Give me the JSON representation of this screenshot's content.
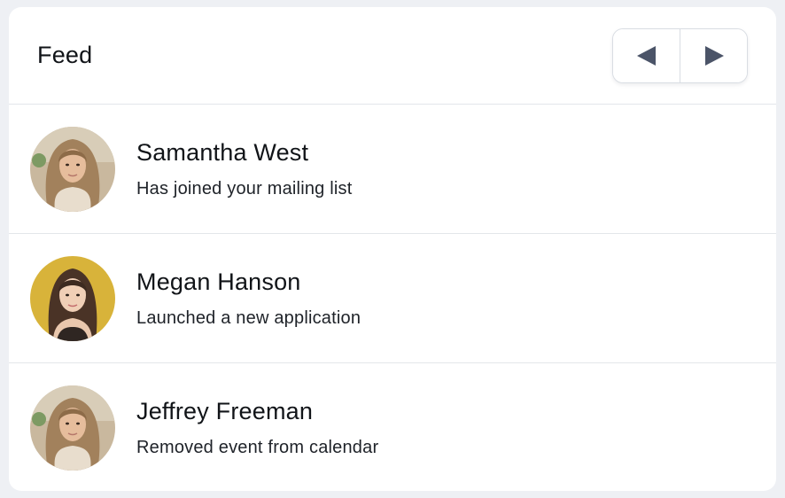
{
  "feed": {
    "title": "Feed",
    "nav": {
      "prev_icon": "triangle-left-icon",
      "next_icon": "triangle-right-icon",
      "icon_color": "#4b5468"
    },
    "items": [
      {
        "name": "Samantha West",
        "action": "Has joined your mailing list",
        "avatar_bg": "#c9b89e",
        "avatar_hair": "#a2815c"
      },
      {
        "name": "Megan Hanson",
        "action": "Launched a new application",
        "avatar_bg": "#d8b33a",
        "avatar_hair": "#4a3326"
      },
      {
        "name": "Jeffrey Freeman",
        "action": "Removed event from calendar",
        "avatar_bg": "#c9b89e",
        "avatar_hair": "#a2815c"
      }
    ]
  }
}
